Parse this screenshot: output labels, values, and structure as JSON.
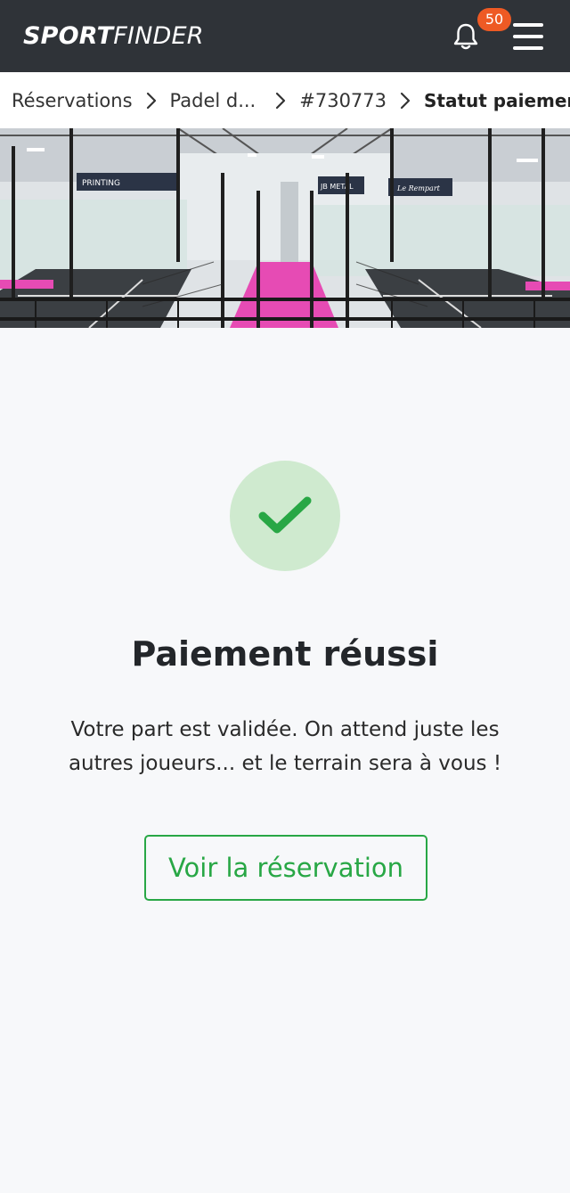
{
  "header": {
    "logo_bold": "SPORT",
    "logo_light": "FINDER",
    "notifications_count": "50",
    "icons": [
      "bell-icon",
      "menu-icon"
    ]
  },
  "breadcrumb": {
    "items": [
      "Réservations",
      "Padel d...",
      "#730773",
      "Statut paiement"
    ]
  },
  "hero": {
    "banners": [
      "PRINTING",
      "JB METAL",
      "Le Rempart"
    ]
  },
  "status": {
    "icon": "check-icon",
    "title": "Paiement réussi",
    "message": "Votre part est validée. On attend juste les autres joueurs... et le terrain sera à vous !",
    "button_label": "Voir la réservation"
  },
  "colors": {
    "header_bg": "#2f3338",
    "badge": "#ee5a24",
    "success": "#28a745",
    "success_light": "#cfeacf",
    "court_pink": "#e64bb4"
  }
}
